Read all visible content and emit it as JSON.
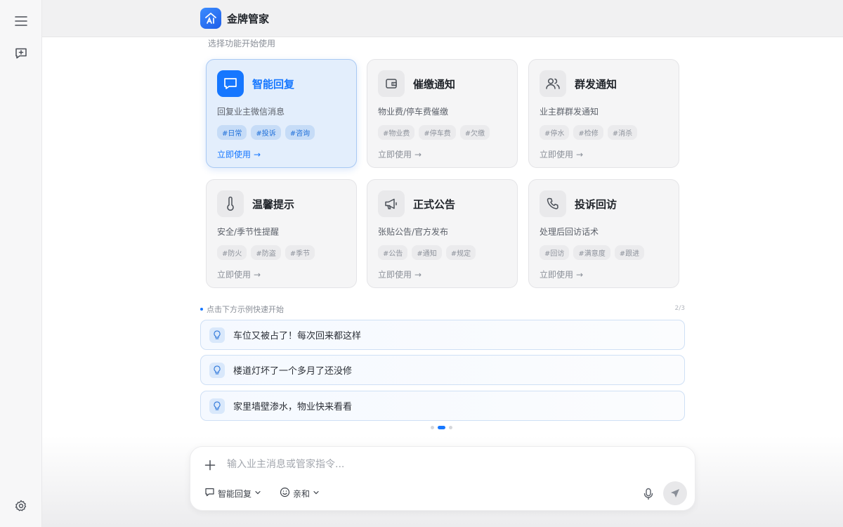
{
  "app": {
    "title": "金牌管家",
    "logo_icon": "house-ai-icon",
    "accent": "#1677ff"
  },
  "sidebar": {
    "menu_icon": "menu-icon",
    "new_chat_icon": "new-chat-icon",
    "settings_icon": "gear-icon"
  },
  "features": {
    "hint": "选择功能开始使用",
    "cards": [
      {
        "title": "智能回复",
        "desc": "回复业主微信消息",
        "tags": [
          "#日常",
          "#投诉",
          "#咨询"
        ],
        "link": "立即使用",
        "icon": "chat-bubble-icon",
        "active": true
      },
      {
        "title": "催缴通知",
        "desc": "物业费/停车费催缴",
        "tags": [
          "#物业费",
          "#停车费",
          "#欠缴"
        ],
        "link": "立即使用",
        "icon": "wallet-icon",
        "active": false
      },
      {
        "title": "群发通知",
        "desc": "业主群群发通知",
        "tags": [
          "#停水",
          "#检修",
          "#消杀"
        ],
        "link": "立即使用",
        "icon": "users-icon",
        "active": false
      },
      {
        "title": "温馨提示",
        "desc": "安全/季节性提醒",
        "tags": [
          "#防火",
          "#防盗",
          "#季节"
        ],
        "link": "立即使用",
        "icon": "thermometer-icon",
        "active": false
      },
      {
        "title": "正式公告",
        "desc": "张贴公告/官方发布",
        "tags": [
          "#公告",
          "#通知",
          "#规定"
        ],
        "link": "立即使用",
        "icon": "megaphone-icon",
        "active": false
      },
      {
        "title": "投诉回访",
        "desc": "处理后回访话术",
        "tags": [
          "#回访",
          "#满意度",
          "#跟进"
        ],
        "link": "立即使用",
        "icon": "phone-icon",
        "active": false
      }
    ]
  },
  "examples": {
    "label": "点击下方示例快速开始",
    "page": "2/3",
    "items": [
      "车位又被占了！每次回来都这样",
      "楼道灯坏了一个多月了还没修",
      "家里墙壁渗水，物业快来看看"
    ],
    "item_icon": "lightbulb-icon",
    "pager_total": 3,
    "pager_current": 2
  },
  "composer": {
    "placeholder": "输入业主消息或管家指令...",
    "value": "",
    "mode_label": "智能回复",
    "tone_label": "亲和",
    "plus_icon": "plus-icon",
    "mic_icon": "microphone-icon",
    "send_icon": "send-icon"
  }
}
